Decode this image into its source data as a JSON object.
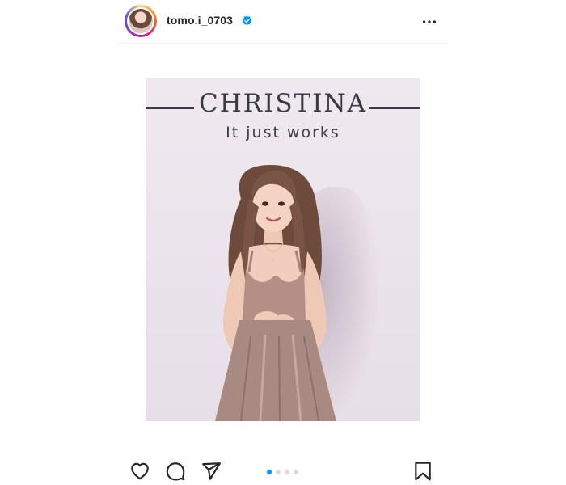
{
  "post": {
    "username": "tomo.i_0703",
    "verified": true,
    "avatar": "profile-photo",
    "more_icon": "more-horizontal-icon"
  },
  "photo": {
    "brand": "CHRISTINA",
    "tagline": "It just works"
  },
  "carousel": {
    "total": 4,
    "current": 1
  },
  "actions": {
    "like_icon": "heart-icon",
    "comment_icon": "comment-icon",
    "share_icon": "share-icon",
    "save_icon": "bookmark-icon"
  },
  "colors": {
    "accent": "#0095f6",
    "text": "#262626",
    "divider": "#efefef"
  }
}
